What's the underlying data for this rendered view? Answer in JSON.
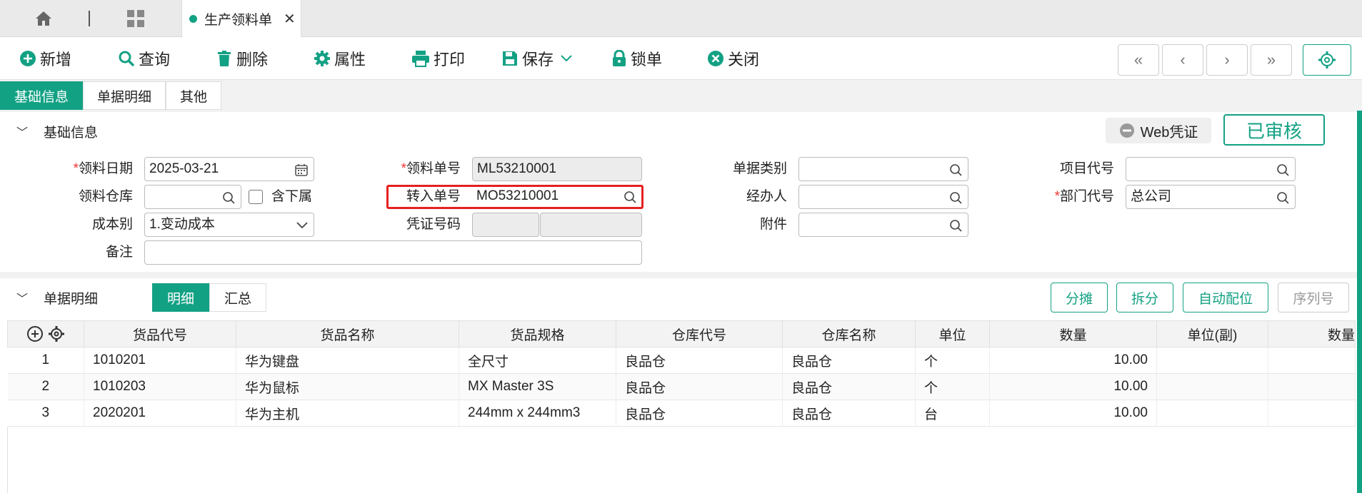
{
  "tabs": {
    "active_label": "生产领料单",
    "close_glyph": "✕"
  },
  "toolbar": {
    "add": "新增",
    "query": "查询",
    "delete": "删除",
    "props": "属性",
    "print": "打印",
    "save": "保存",
    "lock": "锁单",
    "close": "关闭",
    "nav": [
      "«",
      "‹",
      "›",
      "»"
    ]
  },
  "subtabs": [
    "基础信息",
    "单据明细",
    "其他"
  ],
  "basic": {
    "title": "基础信息",
    "web_voucher": "Web凭证",
    "status": "已审核",
    "fields": {
      "pick_date_label": "领料日期",
      "pick_date": "2025-03-21",
      "pick_no_label": "领料单号",
      "pick_no": "ML53210001",
      "doc_type_label": "单据类别",
      "doc_type": "",
      "project_label": "项目代号",
      "project": "",
      "warehouse_label": "领料仓库",
      "warehouse": "",
      "include_sub_label": "含下属",
      "transfer_no_label": "转入单号",
      "transfer_no": "MO53210001",
      "handler_label": "经办人",
      "handler": "",
      "dept_label": "部门代号",
      "dept": "总公司",
      "cost_type_label": "成本别",
      "cost_type": "1.变动成本",
      "voucher_no_label": "凭证号码",
      "attach_label": "附件",
      "remark_label": "备注",
      "remark": ""
    }
  },
  "detail": {
    "title": "单据明细",
    "views": [
      "明细",
      "汇总"
    ],
    "actions": [
      "分摊",
      "拆分",
      "自动配位",
      "序列号"
    ],
    "columns": [
      "货品代号",
      "货品名称",
      "货品规格",
      "仓库代号",
      "仓库名称",
      "单位",
      "数量",
      "单位(副)",
      "数量"
    ],
    "rows": [
      [
        "1",
        "1010201",
        "华为键盘",
        "全尺寸",
        "良品仓",
        "良品仓",
        "个",
        "10.00",
        "",
        ""
      ],
      [
        "2",
        "1010203",
        "华为鼠标",
        "MX Master 3S",
        "良品仓",
        "良品仓",
        "个",
        "10.00",
        "",
        ""
      ],
      [
        "3",
        "2020201",
        "华为主机",
        "244mm x 244mm3",
        "良品仓",
        "良品仓",
        "台",
        "10.00",
        "",
        ""
      ]
    ]
  },
  "colors": {
    "accent": "#13a184",
    "highlight": "#e52020"
  }
}
